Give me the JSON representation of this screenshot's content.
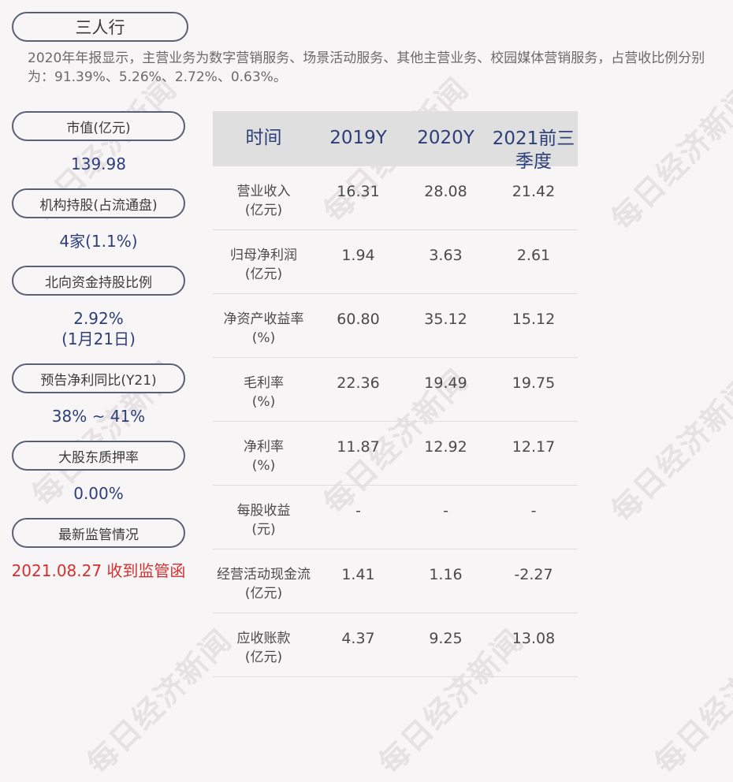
{
  "company": "三人行",
  "summary": "2020年年报显示，主营业务为数字营销服务、场景活动服务、其他主营业务、校园媒体营销服务，占营收比例分别为：91.39%、5.26%、2.72%、0.63%。",
  "watermark": "每日经济新闻",
  "metrics": [
    {
      "label": "市值(亿元)",
      "value": "139.98"
    },
    {
      "label": "机构持股(占流通盘)",
      "value": "4家(1.1%)"
    },
    {
      "label": "北向资金持股比例",
      "value": "2.92%",
      "value2": "(1月21日)"
    },
    {
      "label": "预告净利同比(Y21)",
      "value": "38% ~ 41%"
    },
    {
      "label": "大股东质押率",
      "value": "0.00%"
    },
    {
      "label": "最新监管情况",
      "value": "2021.08.27 收到监管函"
    }
  ],
  "table": {
    "headers": [
      "时间",
      "2019Y",
      "2020Y",
      "2021前三季度"
    ],
    "rows": [
      {
        "label": "营业收入",
        "unit": "(亿元)",
        "values": [
          "16.31",
          "28.08",
          "21.42"
        ]
      },
      {
        "label": "归母净利润",
        "unit": "(亿元)",
        "values": [
          "1.94",
          "3.63",
          "2.61"
        ]
      },
      {
        "label": "净资产收益率",
        "unit": "(%)",
        "values": [
          "60.80",
          "35.12",
          "15.12"
        ]
      },
      {
        "label": "毛利率",
        "unit": "(%)",
        "values": [
          "22.36",
          "19.49",
          "19.75"
        ]
      },
      {
        "label": "净利率",
        "unit": "(%)",
        "values": [
          "11.87",
          "12.92",
          "12.17"
        ]
      },
      {
        "label": "每股收益",
        "unit": "(元)",
        "values": [
          "-",
          "-",
          "-"
        ]
      },
      {
        "label": "经营活动现金流",
        "unit": "(亿元)",
        "values": [
          "1.41",
          "1.16",
          "-2.27"
        ]
      },
      {
        "label": "应收账款",
        "unit": "(亿元)",
        "values": [
          "4.37",
          "9.25",
          "13.08"
        ]
      }
    ]
  }
}
